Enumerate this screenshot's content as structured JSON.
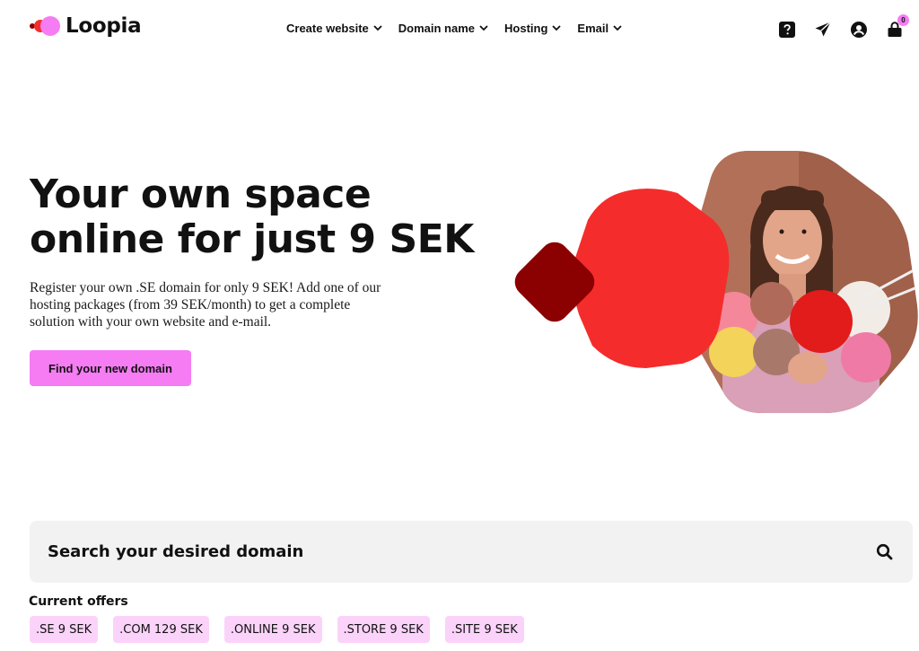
{
  "brand": {
    "name": "Loopia"
  },
  "nav": {
    "items": [
      {
        "label": "Create website"
      },
      {
        "label": "Domain name"
      },
      {
        "label": "Hosting"
      },
      {
        "label": "Email"
      }
    ]
  },
  "header_icons": {
    "help": "help-icon",
    "send": "paper-plane-icon",
    "account": "user-icon",
    "cart": "cart-icon",
    "cart_count": "0"
  },
  "hero": {
    "title": "Your own space online for just 9 SEK",
    "text": "Register your own .SE domain for only 9 SEK! Add one of our hosting packages (from 39 SEK/month) to get a complete solution with your own website and e-mail.",
    "cta": "Find your new domain"
  },
  "search": {
    "placeholder": "Search your desired domain"
  },
  "offers": {
    "label": "Current offers",
    "items": [
      {
        "label": ".SE 9 SEK"
      },
      {
        "label": ".COM 129 SEK"
      },
      {
        "label": ".ONLINE 9 SEK"
      },
      {
        "label": ".STORE 9 SEK"
      },
      {
        "label": ".SITE 9 SEK"
      }
    ]
  },
  "colors": {
    "accent_pink": "#f57cf3",
    "light_pink": "#fbd3fa",
    "red": "#f52c2c",
    "dark_red": "#8b0000",
    "search_bg": "#f2f2f2"
  }
}
